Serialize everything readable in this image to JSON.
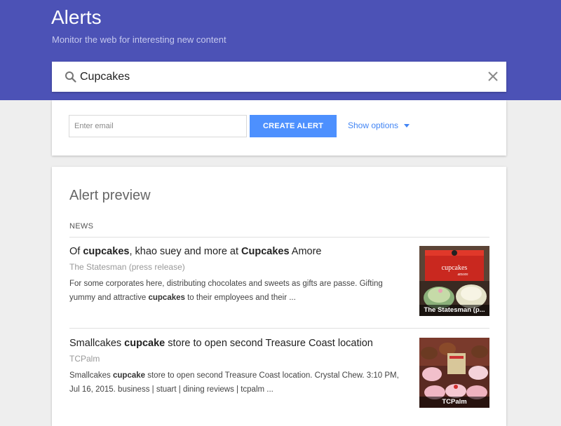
{
  "header": {
    "title": "Alerts",
    "subtitle": "Monitor the web for interesting new content",
    "background_color": "#4c52b6"
  },
  "search": {
    "value": "Cupcakes",
    "search_icon": "search-icon",
    "clear_icon": "close-icon"
  },
  "options": {
    "email_placeholder": "Enter email",
    "create_label": "CREATE ALERT",
    "show_options_label": "Show options",
    "accent_color": "#4d90fe"
  },
  "preview": {
    "title": "Alert preview",
    "section_label": "NEWS",
    "items": [
      {
        "title_parts": [
          "Of ",
          "cupcakes",
          ", khao suey and more at ",
          "Cupcakes",
          " Amore"
        ],
        "source": "The Statesman (press release)",
        "snippet_parts": [
          "For some corporates here, distributing chocolates and sweets as gifts are passe. Gifting yummy and attractive ",
          "cupcakes",
          " to their employees and their ..."
        ],
        "thumb_caption": "The Statesman (p..."
      },
      {
        "title_parts": [
          "Smallcakes ",
          "cupcake",
          " store to open second Treasure Coast location"
        ],
        "source": "TCPalm",
        "snippet_parts": [
          "Smallcakes ",
          "cupcake",
          " store to open second Treasure Coast location. Crystal Chew. 3:10 PM, Jul 16, 2015. business | stuart | dining reviews | tcpalm ..."
        ],
        "thumb_caption": "TCPalm"
      }
    ]
  }
}
